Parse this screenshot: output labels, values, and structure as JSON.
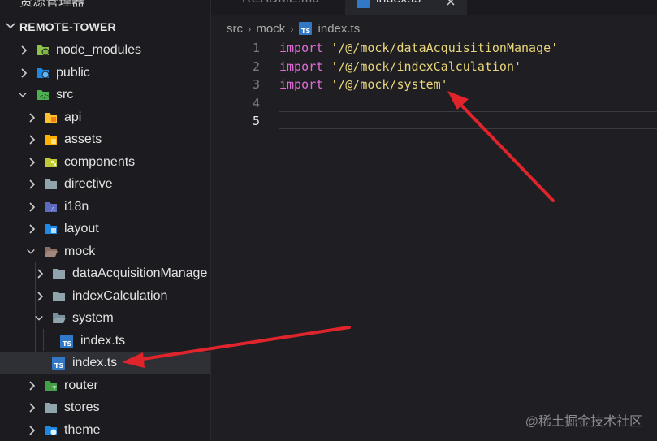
{
  "tabs": [
    {
      "label": "README.md",
      "icon": "markdown-icon"
    },
    {
      "label": "index.ts",
      "icon": "typescript-icon",
      "active": true
    }
  ],
  "explorer": {
    "cut_title": "资源管理器",
    "project_name": "REMOTE-TOWER",
    "tree": [
      {
        "label": "node_modules",
        "icon": "node-folder-icon",
        "expanded": false
      },
      {
        "label": "public",
        "icon": "public-folder-icon",
        "expanded": false
      },
      {
        "label": "src",
        "icon": "src-folder-icon",
        "expanded": true
      },
      {
        "label": "api",
        "icon": "api-folder-icon",
        "expanded": false
      },
      {
        "label": "assets",
        "icon": "assets-folder-icon",
        "expanded": false
      },
      {
        "label": "components",
        "icon": "components-folder-icon",
        "expanded": false
      },
      {
        "label": "directive",
        "icon": "folder-icon",
        "expanded": false
      },
      {
        "label": "i18n",
        "icon": "i18n-folder-icon",
        "expanded": false
      },
      {
        "label": "layout",
        "icon": "layout-folder-icon",
        "expanded": false
      },
      {
        "label": "mock",
        "icon": "mock-folder-open-icon",
        "expanded": true
      },
      {
        "label": "dataAcquisitionManage",
        "icon": "folder-icon",
        "expanded": false
      },
      {
        "label": "indexCalculation",
        "icon": "folder-icon",
        "expanded": false
      },
      {
        "label": "system",
        "icon": "folder-open-icon",
        "expanded": true
      },
      {
        "label": "index.ts",
        "icon": "typescript-icon"
      },
      {
        "label": "index.ts",
        "icon": "typescript-icon",
        "selected": true
      },
      {
        "label": "router",
        "icon": "router-folder-icon",
        "expanded": false
      },
      {
        "label": "stores",
        "icon": "folder-icon",
        "expanded": false
      },
      {
        "label": "theme",
        "icon": "theme-folder-icon",
        "expanded": false
      }
    ]
  },
  "breadcrumb": [
    "src",
    "mock",
    "index.ts"
  ],
  "editor": {
    "line_numbers": [
      "1",
      "2",
      "3",
      "4",
      "5"
    ],
    "current_line": "5",
    "lines": [
      {
        "keyword": "import",
        "string": "'/@/mock/dataAcquisitionManage'"
      },
      {
        "keyword": "import",
        "string": "'/@/mock/indexCalculation'"
      },
      {
        "keyword": "import",
        "string": "'/@/mock/system'"
      }
    ]
  },
  "watermark": "@稀土掘金技术社区",
  "colors": {
    "annotation_arrow": "#e0242c",
    "keyword": "#e06bd8",
    "string": "#e8d57b",
    "typescript_badge": "#3178c6"
  }
}
